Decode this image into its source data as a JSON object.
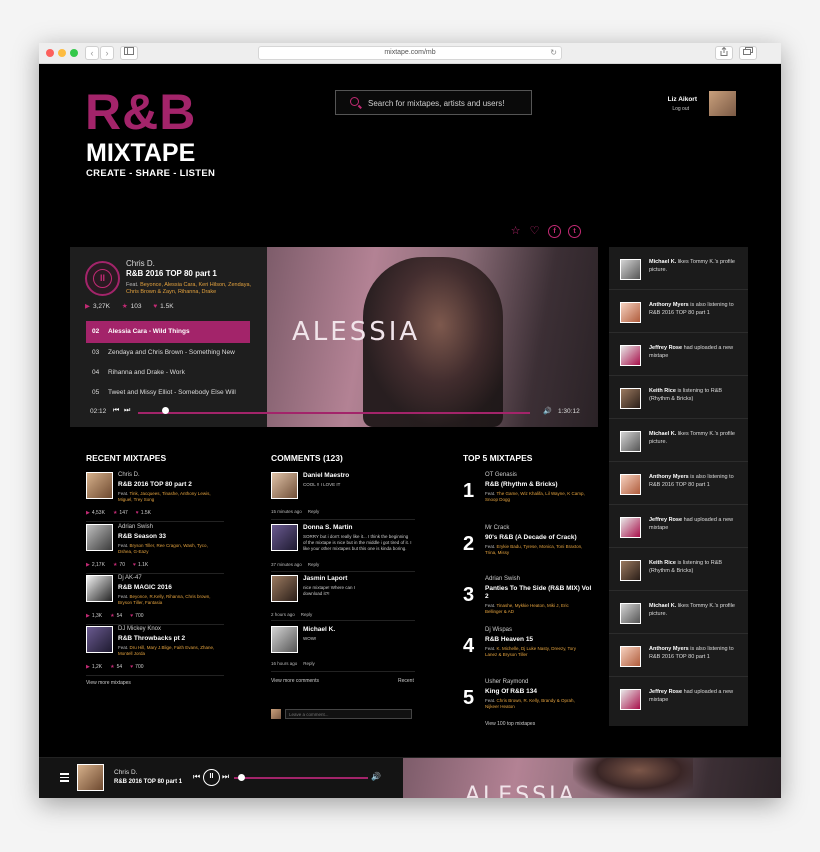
{
  "browser": {
    "url": "mixtape.com/mb",
    "back_glyph": "‹",
    "forward_glyph": "›"
  },
  "brand": {
    "logo_main": "R&B",
    "logo_sub": "MIXTAPE",
    "tagline": "CREATE - SHARE - LISTEN",
    "accent_color": "#a3246a"
  },
  "search": {
    "placeholder": "Search for mixtapes, artists and users!"
  },
  "user": {
    "name": "Liz Aikort",
    "logout": "Log out"
  },
  "social_icons": [
    "star-icon",
    "heart-icon",
    "facebook-icon",
    "twitter-icon"
  ],
  "player": {
    "artist": "Chris D.",
    "title": "R&B 2016 TOP 80 part 1",
    "feat_prefix": "Feat.",
    "feat_names": "Beyonce, Alessia Cara, Keri Hilson, Zendaya, Chris Brown & Zayn, Rihanna, Drake",
    "stats": {
      "plays": "3,27K",
      "stars": "103",
      "likes": "1.5K"
    },
    "tracks": [
      {
        "num": "02",
        "title": "Alessia Cara - Wild Things"
      },
      {
        "num": "03",
        "title": "Zendaya and Chris Brown - Something New"
      },
      {
        "num": "04",
        "title": "Rihanna and Drake - Work"
      },
      {
        "num": "05",
        "title": "Tweet and Missy Elliot - Somebody Else Will"
      }
    ],
    "cover_text": "ALESSIA",
    "time_current": "02:12",
    "time_total": "1:30:12",
    "progress_fraction": 0.07
  },
  "recent": {
    "heading": "RECENT MIXTAPES",
    "view_more": "View more mixtapes",
    "items": [
      {
        "artist": "Chris D.",
        "title": "R&B 2016 TOP 80 part 2",
        "feat": "Tink, Jacquees, Tinashe, Anthony Lewis, Miguel, Trey Song",
        "plays": "4,53K",
        "stars": "147",
        "likes": "1.5K"
      },
      {
        "artist": "Adrian Swish",
        "title": "R&B Season 33",
        "feat": "Bryson Tiller, Ree Cragon, Wash, Tyco, Dshea, G-Eazy",
        "plays": "2,17K",
        "stars": "70",
        "likes": "1.1K"
      },
      {
        "artist": "Dj AK-47",
        "title": "R&B MAGIC 2016",
        "feat": "Beyonce, R.Kelly, Rihanna, Chris brown, Bryson Tiller, Fantasia",
        "plays": "1,3K",
        "stars": "54",
        "likes": "700"
      },
      {
        "artist": "DJ Mickey Knox",
        "title": "R&B Throwbacks pt 2",
        "feat": "Dru Hill, Mary J.Blige, Faith Evans, Zhane, Montell Jorda",
        "plays": "1,2K",
        "stars": "54",
        "likes": "700"
      }
    ]
  },
  "comments": {
    "heading": "COMMENTS  (123)",
    "reply_label": "Reply",
    "view_more": "View more comments",
    "recent_label": "Recent",
    "input_placeholder": "Leave a comment...",
    "items": [
      {
        "name": "Daniel Maestro",
        "text": "COOL !! I LOVE IT",
        "time": "15 minutes ago"
      },
      {
        "name": "Donna S. Martin",
        "text": "SORRY but i don't really like it... I think the beginning of the mixtape is nice but in the middle i got tired of it. I like your other mixtapes but this one is kinda boring.",
        "time": "37 minutes ago"
      },
      {
        "name": "Jasmin Laport",
        "text": "nice mixtape! Where can I download it?!",
        "time": "2 hours ago"
      },
      {
        "name": "Michael K.",
        "text": "WOW!",
        "time": "16 hours ago"
      }
    ]
  },
  "top5": {
    "heading": "TOP 5 MIXTAPES",
    "view_more": "View 100 top mixtapes",
    "items": [
      {
        "rank": "1",
        "artist": "OT Genasis",
        "title": "R&B (Rhythm & Bricks)",
        "feat": "The Game, Wiz Khalifa, Lil Wayne, K Camp, Snoop Dogg"
      },
      {
        "rank": "2",
        "artist": "Mr Crack",
        "title": "90's R&B (A Decade of Crack)",
        "feat": "Erykie Badu, Tyrese, Monica, Toni Braxton, Trina, Missy"
      },
      {
        "rank": "3",
        "artist": "Adrian Swish",
        "title": "Panties To The Side (R&B MIX) Vol 2",
        "feat": "Tinashe, Mykkie Heaton, Miki J, Eric Bellinger & AD"
      },
      {
        "rank": "4",
        "artist": "Dj Wispas",
        "title": "R&B Heaven 15",
        "feat": "K. Michelle, Dj Luke Nasty, Dreezy, Tory Lanez & Bryson Tiller"
      },
      {
        "rank": "5",
        "artist": "Usher Raymond",
        "title": "King Of R&B 134",
        "feat": "Chris Brown, R. Kelly, Brandy & Oprah, Nijkeer Heaton"
      }
    ]
  },
  "activity": [
    {
      "user": "Michael K.",
      "text": "likes Tommy K.'s profile picture."
    },
    {
      "user": "Anthony Myers",
      "text": "is also listening to R&B 2016 TOP 80 part 1"
    },
    {
      "user": "Jeffrey Rose",
      "text": "had uploaded a new mixtape"
    },
    {
      "user": "Keith Rice",
      "text": "is listening to R&B (Rhythm & Bricks)"
    },
    {
      "user": "Michael K.",
      "text": "likes Tommy K.'s profile picture."
    },
    {
      "user": "Anthony Myers",
      "text": "is also listening to R&B 2016 TOP 80 part 1"
    },
    {
      "user": "Jeffrey Rose",
      "text": "had uploaded a new mixtape"
    },
    {
      "user": "Keith Rice",
      "text": "is listening to R&B (Rhythm & Bricks)"
    },
    {
      "user": "Michael K.",
      "text": "likes Tommy K.'s profile picture."
    },
    {
      "user": "Anthony Myers",
      "text": "is also listening to R&B 2016 TOP 80 part 1"
    },
    {
      "user": "Jeffrey Rose",
      "text": "had uploaded a new mixtape"
    }
  ],
  "bottom_player": {
    "artist": "Chris D.",
    "title": "R&B 2016 TOP 80 part 1",
    "cover_text": "ALESSIA",
    "progress_fraction": 0.05
  }
}
